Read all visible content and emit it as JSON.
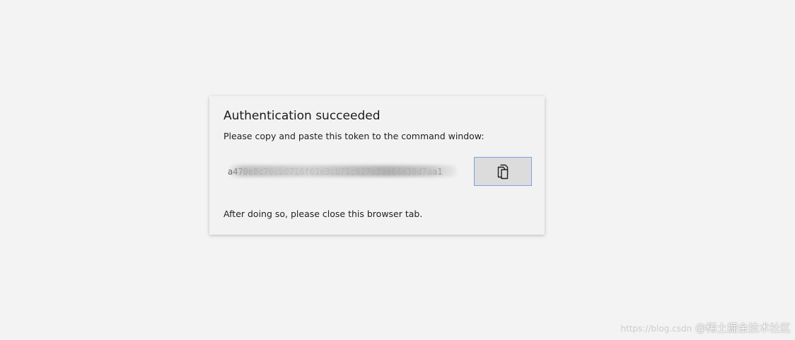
{
  "dialog": {
    "title": "Authentication succeeded",
    "instruction": "Please copy and paste this token to the command window:",
    "token_value": "a470e8c76cb0716f61e3cb71c627e3ae64e38d7aa1",
    "copy_button": {
      "icon": "copy-icon",
      "accent_border": "#7da3df",
      "background": "#dcdcdc"
    },
    "closing_text": "After doing so, please close this browser tab."
  },
  "watermark": {
    "faint_text": "https://blog.csdn",
    "text": "@稀土掘金技术社区"
  },
  "colors": {
    "page_background": "#f3f3f3",
    "card_background": "#f2f2f2"
  }
}
